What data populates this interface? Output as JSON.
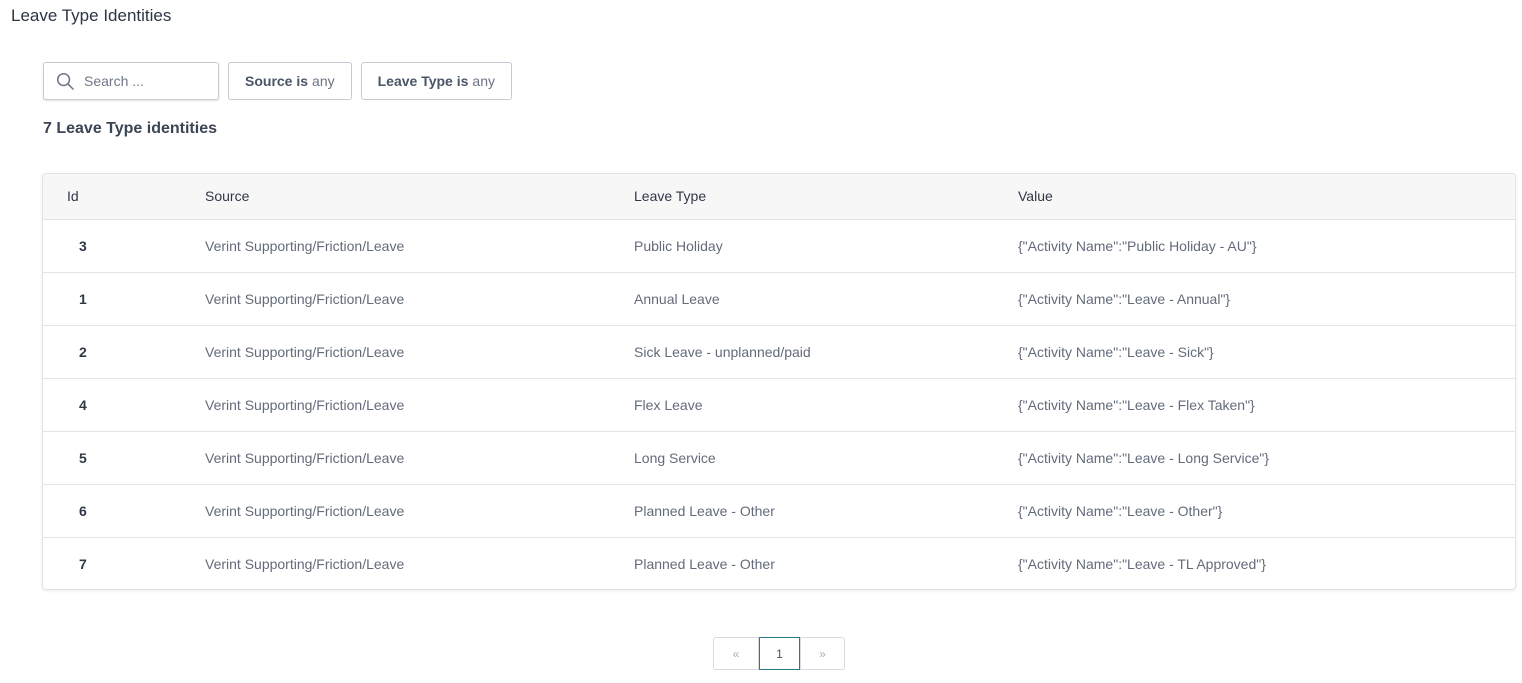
{
  "page": {
    "title": "Leave Type Identities"
  },
  "filters": {
    "search_placeholder": "Search ...",
    "source": {
      "name": "Source is",
      "value": "any"
    },
    "leave_type": {
      "name": "Leave Type is",
      "value": "any"
    }
  },
  "summary": {
    "count_text": "7 Leave Type identities"
  },
  "table": {
    "headers": {
      "id": "Id",
      "source": "Source",
      "leave_type": "Leave Type",
      "value": "Value"
    },
    "rows": [
      {
        "id": "3",
        "source": "Verint Supporting/Friction/Leave",
        "leave_type": "Public Holiday",
        "value": "{\"Activity Name\":\"Public Holiday - AU\"}"
      },
      {
        "id": "1",
        "source": "Verint Supporting/Friction/Leave",
        "leave_type": "Annual Leave",
        "value": "{\"Activity Name\":\"Leave - Annual\"}"
      },
      {
        "id": "2",
        "source": "Verint Supporting/Friction/Leave",
        "leave_type": "Sick Leave - unplanned/paid",
        "value": "{\"Activity Name\":\"Leave - Sick\"}"
      },
      {
        "id": "4",
        "source": "Verint Supporting/Friction/Leave",
        "leave_type": "Flex Leave",
        "value": "{\"Activity Name\":\"Leave - Flex Taken\"}"
      },
      {
        "id": "5",
        "source": "Verint Supporting/Friction/Leave",
        "leave_type": "Long Service",
        "value": "{\"Activity Name\":\"Leave - Long Service\"}"
      },
      {
        "id": "6",
        "source": "Verint Supporting/Friction/Leave",
        "leave_type": "Planned Leave - Other",
        "value": "{\"Activity Name\":\"Leave - Other\"}"
      },
      {
        "id": "7",
        "source": "Verint Supporting/Friction/Leave",
        "leave_type": "Planned Leave - Other",
        "value": "{\"Activity Name\":\"Leave - TL Approved\"}"
      }
    ]
  },
  "pagination": {
    "prev_glyph": "«",
    "current_page": "1",
    "next_glyph": "»"
  },
  "colors": {
    "accent": "#2b7a86",
    "text": "#2f3b4c",
    "muted": "#636b7a",
    "border": "#e1e4e8"
  },
  "icons": {
    "search": "search-icon"
  }
}
